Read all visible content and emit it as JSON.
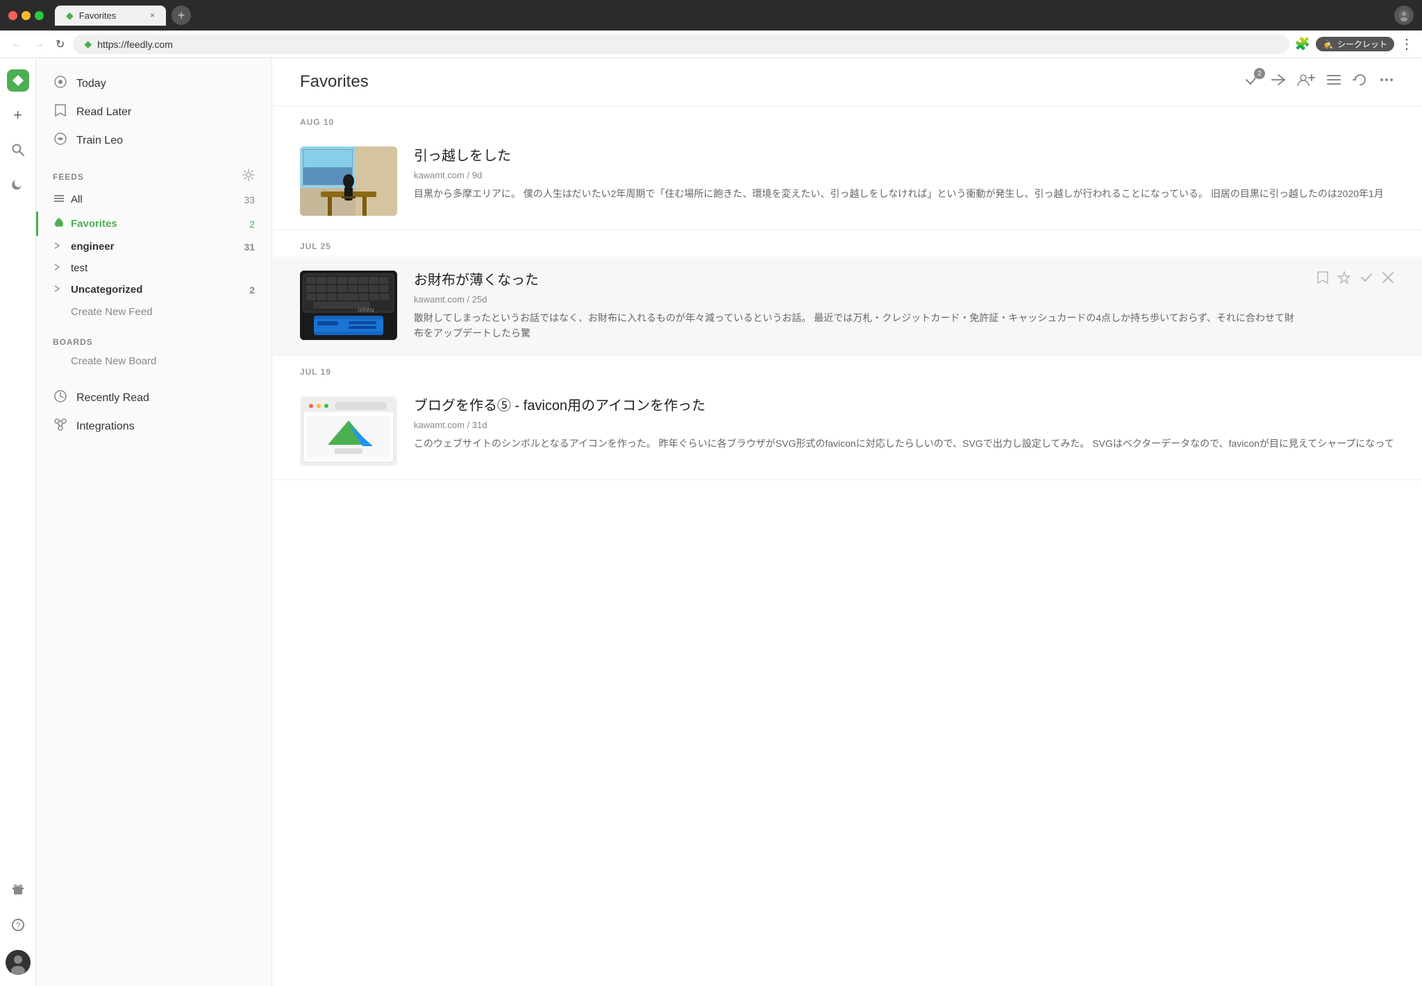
{
  "browser": {
    "tab_title": "Favorites",
    "tab_icon": "◆",
    "close_tab": "×",
    "new_tab": "+",
    "back_btn": "←",
    "forward_btn": "→",
    "refresh_btn": "↻",
    "url": "https://feedly.com",
    "extensions_icon": "🧩",
    "incognito_icon": "🕵",
    "incognito_label": "シークレット",
    "menu_icon": "⋮"
  },
  "rail": {
    "logo": "◆",
    "add_btn": "+",
    "search_btn": "🔍",
    "night_btn": "🌙",
    "gift_btn": "🎁",
    "help_btn": "?"
  },
  "sidebar": {
    "today_label": "Today",
    "read_later_label": "Read Later",
    "train_leo_label": "Train Leo",
    "feeds_section": "FEEDS",
    "all_label": "All",
    "all_count": "33",
    "favorites_label": "Favorites",
    "favorites_count": "2",
    "engineer_label": "engineer",
    "engineer_count": "31",
    "test_label": "test",
    "uncategorized_label": "Uncategorized",
    "uncategorized_count": "2",
    "create_new_feed": "Create New Feed",
    "boards_section": "BOARDS",
    "create_new_board": "Create New Board",
    "recently_read_label": "Recently Read",
    "integrations_label": "Integrations"
  },
  "content": {
    "title": "Favorites",
    "badge_count": "2",
    "groups": [
      {
        "date": "AUG 10",
        "articles": [
          {
            "id": "article-1",
            "title": "引っ越しをした",
            "source": "kawamt.com / 9d",
            "excerpt": "目黒から多摩エリアに。 僕の人生はだいたい2年周期で「住む場所に飽きた、環境を変えたい、引っ越しをしなければ」という衝動が発生し、引っ越しが行われることになっている。 旧居の目黒に引っ越したのは2020年1月",
            "thumb_type": "1",
            "highlighted": false
          }
        ]
      },
      {
        "date": "JUL 25",
        "articles": [
          {
            "id": "article-2",
            "title": "お財布が薄くなった",
            "source": "kawamt.com / 25d",
            "excerpt": "散財してしまったというお話ではなく、お財布に入れるものが年々減っているというお話。 最近では万札・クレジットカード・免許証・キャッシュカードの4点しか持ち歩いておらず、それに合わせて財布をアップデートしたら驚",
            "thumb_type": "2",
            "highlighted": true
          }
        ]
      },
      {
        "date": "JUL 19",
        "articles": [
          {
            "id": "article-3",
            "title": "ブログを作る⑤ - favicon用のアイコンを作った",
            "source": "kawamt.com / 31d",
            "excerpt": "このウェブサイトのシンボルとなるアイコンを作った。 昨年ぐらいに各ブラウザがSVG形式のfaviconに対応したらしいので、SVGで出力し設定してみた。 SVGはベクターデータなので、faviconが目に見えてシャープになって",
            "thumb_type": "3",
            "highlighted": false
          }
        ]
      }
    ]
  }
}
